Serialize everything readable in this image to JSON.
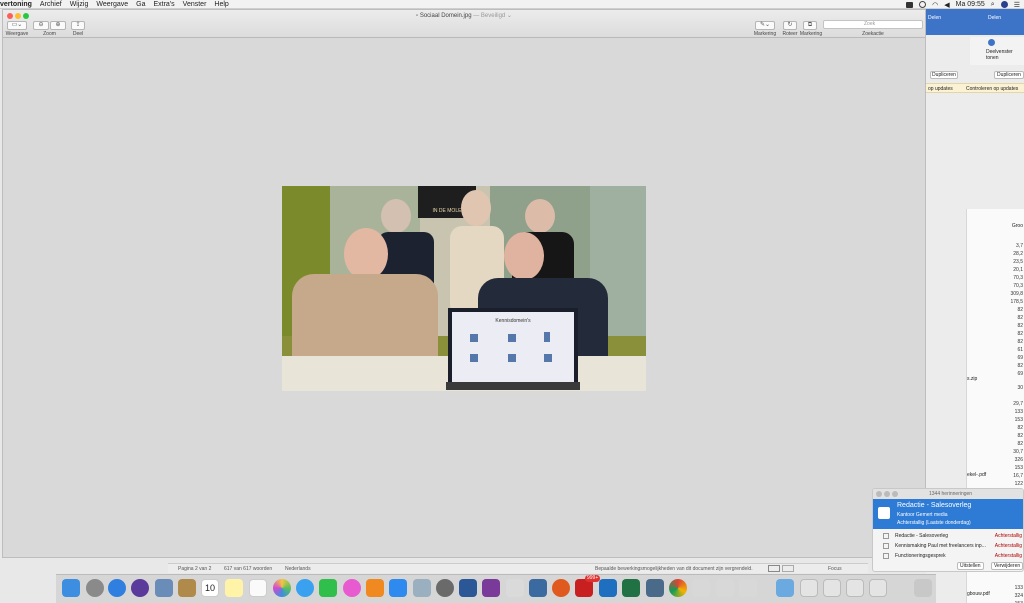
{
  "menubar": {
    "app_name": "vertoning",
    "items": [
      "Archief",
      "Wijzig",
      "Weergave",
      "Ga",
      "Extra's",
      "Venster",
      "Help"
    ],
    "clock": "Ma 09:55"
  },
  "window": {
    "title": "Sociaal Domein.jpg",
    "title_status": "Beveiligd",
    "toolbar_labels": {
      "view": "Weergave",
      "zoom": "Zoom",
      "share": "Deel",
      "markup": "Markering",
      "rotate": "Roteer",
      "markup2": "Markering",
      "search": "Zoekactie"
    },
    "search_placeholder": "Zoek"
  },
  "photo": {
    "poster_text": "IN DE MOLE",
    "screen_title": "Kennisdomein's"
  },
  "right_window": {
    "header_share_1": "Delen",
    "header_share_2": "Delen",
    "share_label": "Deelvenster tonen",
    "duplicate_1": "Dupliceren",
    "duplicate_2": "Dupliceren",
    "updates_1": "op updates",
    "updates_2": "Controleren op updates",
    "col_header": "Groo",
    "file_zip": "s.zip",
    "file_pdf1": "ekel-.pdf",
    "file_pdf2": "gbouw.pdf",
    "sizes": [
      "3,7",
      "28,2",
      "23,5",
      "20,1",
      "70,3",
      "70,3",
      "309,8",
      "178,5",
      "82",
      "82",
      "82",
      "82",
      "82",
      "61",
      "69",
      "82",
      "69",
      "30",
      "29,7",
      "133",
      "153",
      "82",
      "82",
      "82",
      "30,7",
      "326",
      "153",
      "16,7",
      "122",
      "140",
      "133",
      "324",
      "153",
      "67"
    ]
  },
  "status": {
    "page": "Pagina 2 van 2",
    "words": "617 van 617 woorden",
    "lang": "Nederlands",
    "message": "Bepaalde bewerkingsmogelijkheden van dit document zijn vergrendeld.",
    "focus": "Focus"
  },
  "notification": {
    "count": "1344 herinneringen",
    "title": "Redactie - Salesoverleg",
    "subtitle": "Kantoor Gemert media",
    "detail": "Achterstallig (Laatste donderdag)",
    "items": [
      {
        "label": "Redactie - Salesoverleg",
        "status": "Achterstallig"
      },
      {
        "label": "Kennismaking Paul  met freelancers inp...",
        "status": "Achterstallig"
      },
      {
        "label": "Functioneringsgesprek",
        "status": "Achterstallig"
      }
    ],
    "snooze": "Uitstellen",
    "dismiss": "Verwijderen"
  },
  "dock": {
    "calendar_day": "10",
    "badge": "999+"
  },
  "colors": {
    "accent": "#2e7bd6",
    "overdue": "#b00000"
  }
}
